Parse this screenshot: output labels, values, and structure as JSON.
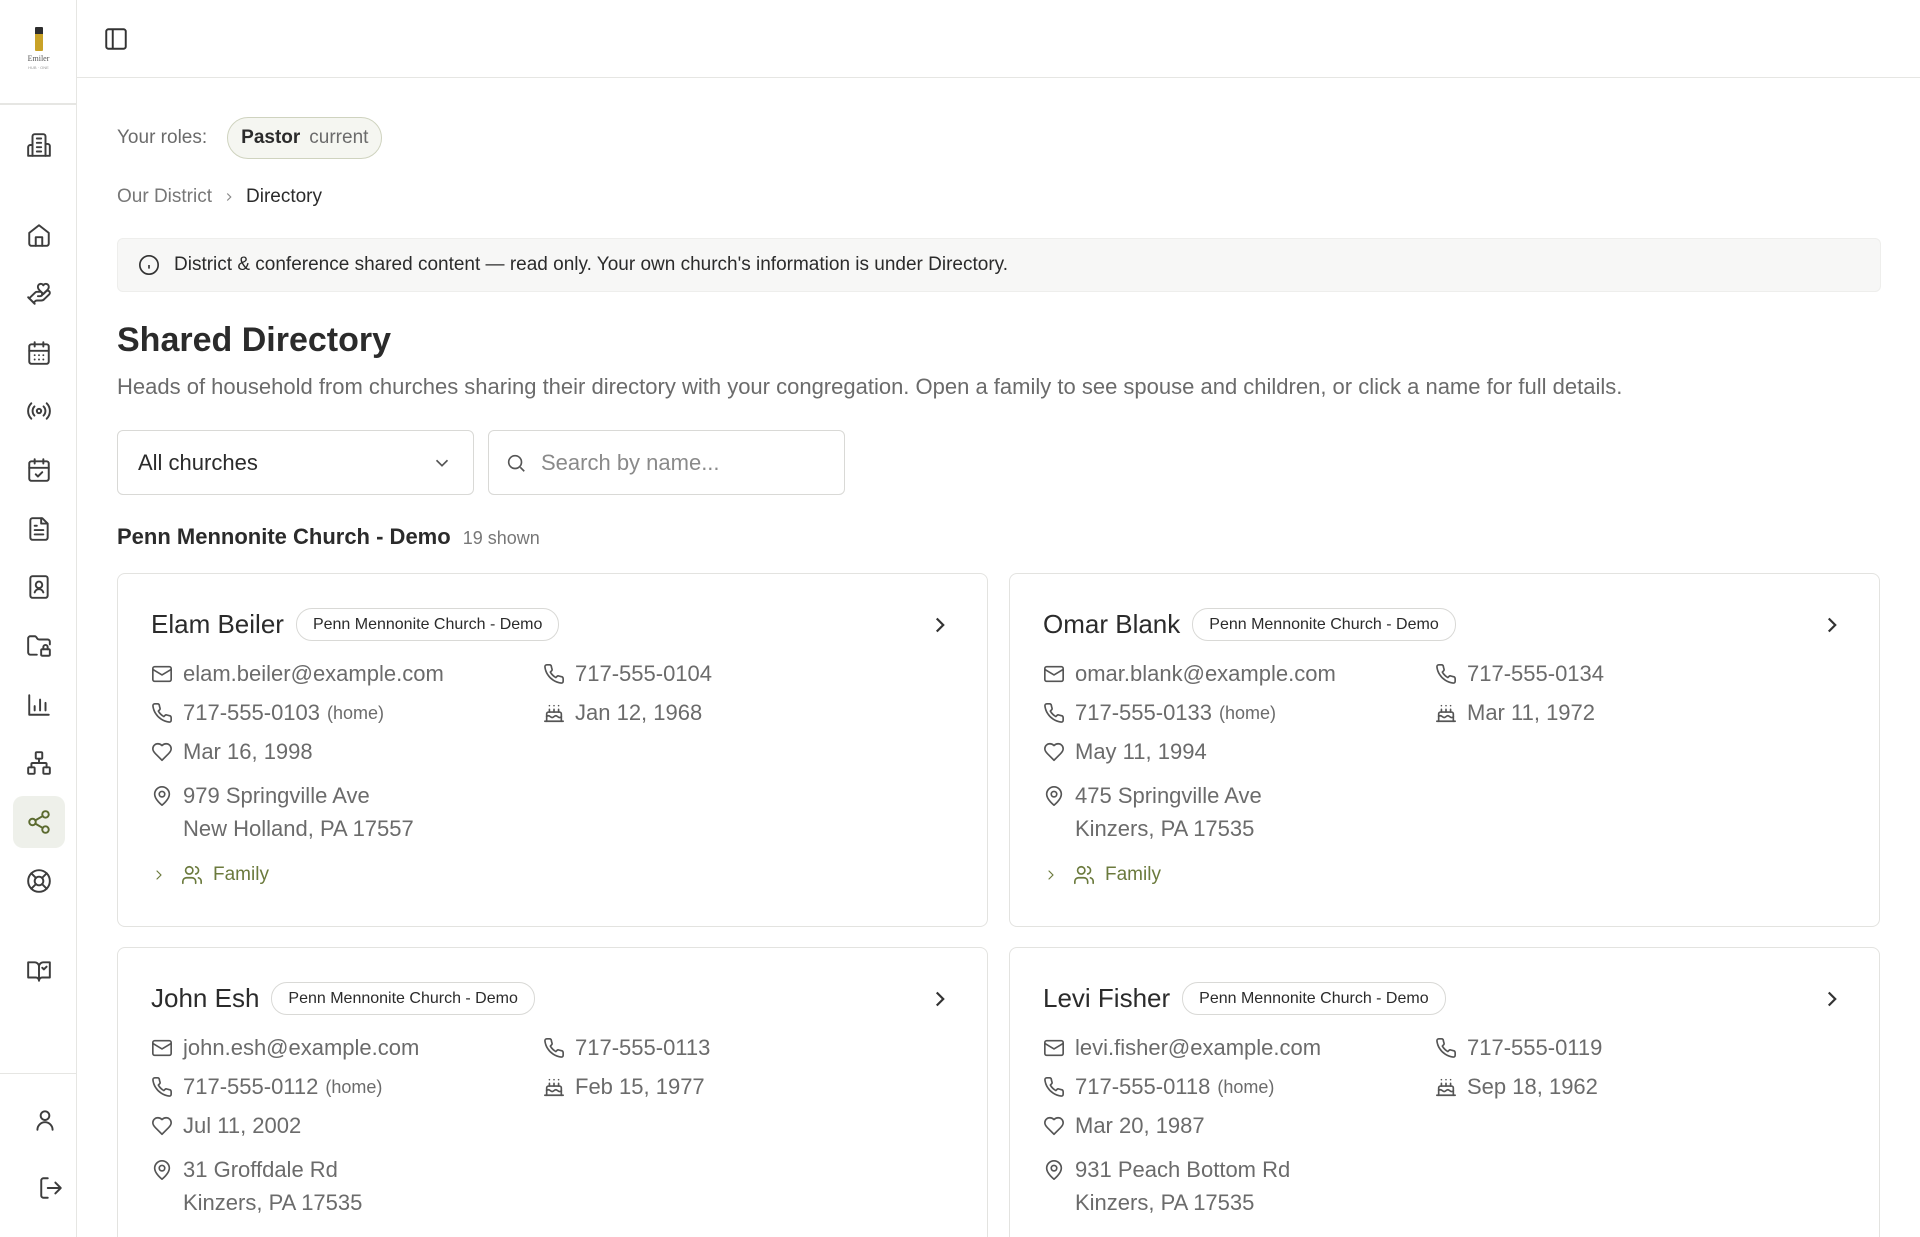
{
  "logo": {
    "text": "Emiler",
    "sub": "HUB · ONE"
  },
  "roles": {
    "label": "Your roles:",
    "role": "Pastor",
    "tag": "current"
  },
  "breadcrumb": {
    "parent": "Our District",
    "current": "Directory"
  },
  "notice": "District & conference shared content — read only. Your own church's information is under Directory.",
  "page": {
    "title": "Shared Directory",
    "description": "Heads of household from churches sharing their directory with your congregation. Open a family to see spouse and children, or click a name for full details."
  },
  "filters": {
    "church_select": "All churches",
    "search_placeholder": "Search by name..."
  },
  "group": {
    "name": "Penn Mennonite Church - Demo",
    "count": "19 shown"
  },
  "labels": {
    "home_suffix": "(home)",
    "family": "Family"
  },
  "cards": [
    {
      "name": "Elam Beiler",
      "church": "Penn Mennonite Church - Demo",
      "email": "elam.beiler@example.com",
      "mobile": "717-555-0104",
      "home": "717-555-0103",
      "birthday": "Jan 12, 1968",
      "anniversary": "Mar 16, 1998",
      "address1": "979 Springville Ave",
      "address2": "New Holland, PA 17557"
    },
    {
      "name": "Omar Blank",
      "church": "Penn Mennonite Church - Demo",
      "email": "omar.blank@example.com",
      "mobile": "717-555-0134",
      "home": "717-555-0133",
      "birthday": "Mar 11, 1972",
      "anniversary": "May 11, 1994",
      "address1": "475 Springville Ave",
      "address2": "Kinzers, PA 17535"
    },
    {
      "name": "John Esh",
      "church": "Penn Mennonite Church - Demo",
      "email": "john.esh@example.com",
      "mobile": "717-555-0113",
      "home": "717-555-0112",
      "birthday": "Feb 15, 1977",
      "anniversary": "Jul 11, 2002",
      "address1": "31 Groffdale Rd",
      "address2": "Kinzers, PA 17535"
    },
    {
      "name": "Levi Fisher",
      "church": "Penn Mennonite Church - Demo",
      "email": "levi.fisher@example.com",
      "mobile": "717-555-0119",
      "home": "717-555-0118",
      "birthday": "Sep 18, 1962",
      "anniversary": "Mar 20, 1987",
      "address1": "931 Peach Bottom Rd",
      "address2": "Kinzers, PA 17535"
    }
  ],
  "colors": {
    "accent": "#6b7a3d",
    "active_nav_bg": "#eef0ea",
    "border": "#e3e3e0"
  }
}
